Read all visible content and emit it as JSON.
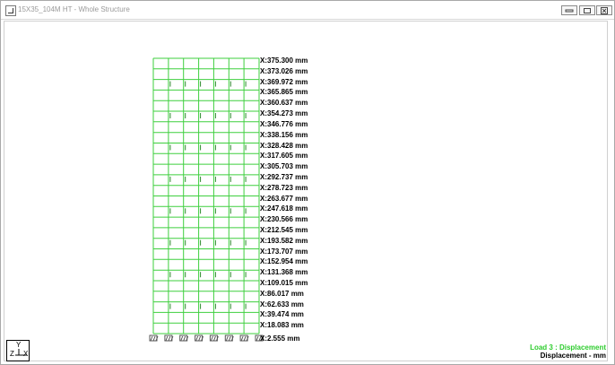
{
  "window": {
    "title": "15X35_104M HT - Whole Structure"
  },
  "window_buttons": {
    "minimize": "minimize-icon",
    "restore": "restore-icon",
    "close": "close-icon"
  },
  "colors": {
    "structure": "#3ecf3e",
    "load_legend": "#2ecc2e",
    "support": "#555555"
  },
  "structure": {
    "bays": 7,
    "stories": 26,
    "supports": 8
  },
  "displacements": [
    "X:375.300 mm",
    "X:373.026 mm",
    "X:369.972 mm",
    "X:365.865 mm",
    "X:360.637 mm",
    "X:354.273 mm",
    "X:346.776 mm",
    "X:338.156 mm",
    "X:328.428 mm",
    "X:317.605 mm",
    "X:305.703 mm",
    "X:292.737 mm",
    "X:278.723 mm",
    "X:263.677 mm",
    "X:247.618 mm",
    "X:230.566 mm",
    "X:212.545 mm",
    "X:193.582 mm",
    "X:173.707 mm",
    "X:152.954 mm",
    "X:131.368 mm",
    "X:109.015 mm",
    "X:86.017 mm",
    "X:62.633 mm",
    "X:39.474 mm",
    "X:18.083 mm",
    "X:2.555 mm"
  ],
  "axis": {
    "y": "Y",
    "z": "Z",
    "x": "X"
  },
  "legend": {
    "load": "Load 3 : Displacement",
    "units": "Displacement - mm"
  }
}
